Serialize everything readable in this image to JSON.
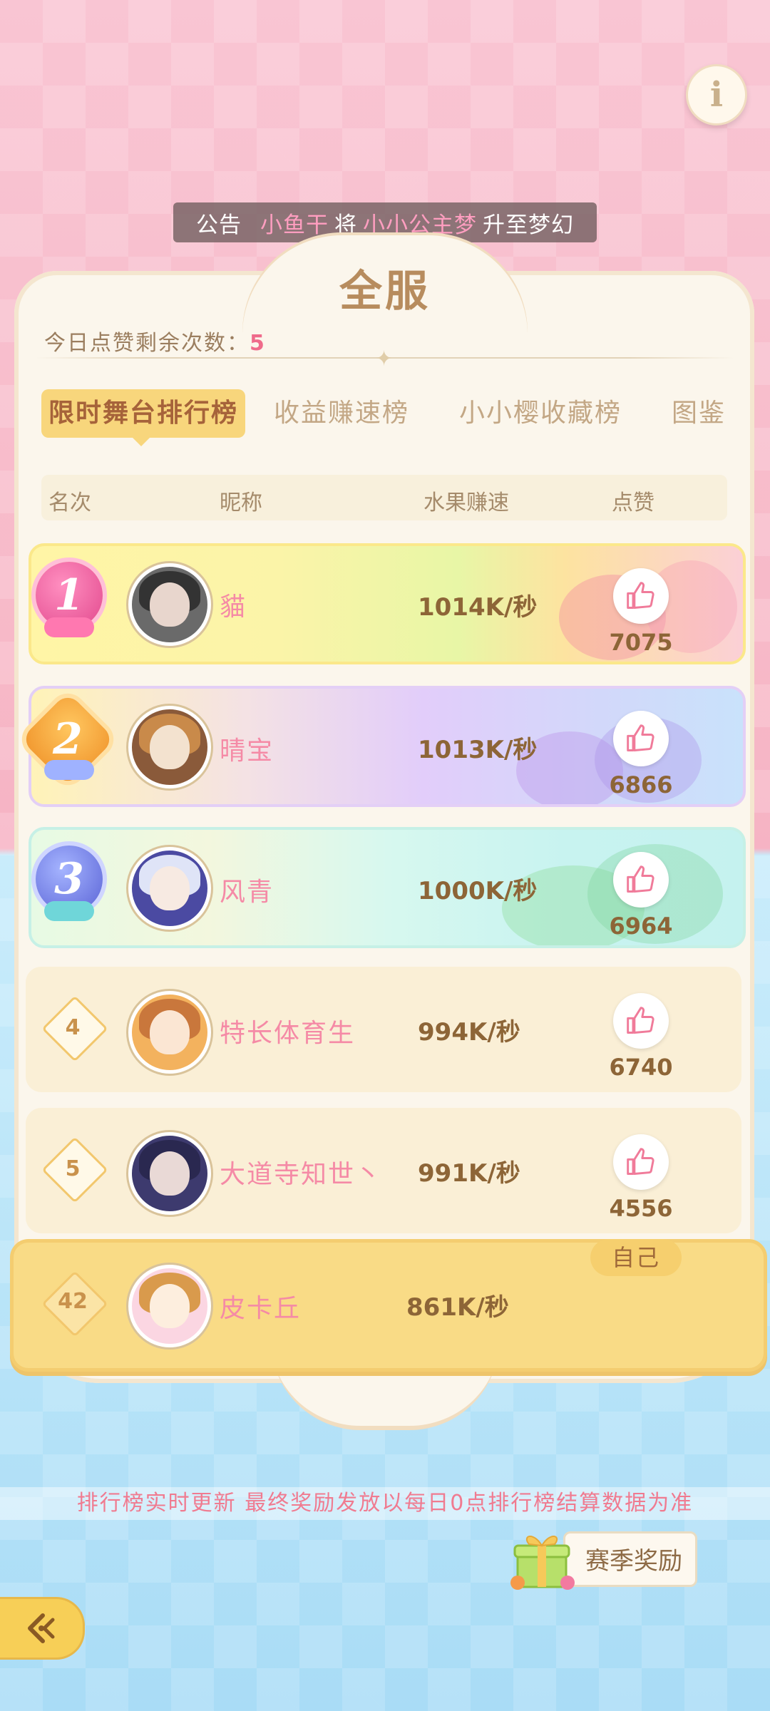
{
  "notice": {
    "label": "公告",
    "user": "小鱼干",
    "verb": "将",
    "target": "小小公主梦",
    "result": "升至梦幻"
  },
  "panel": {
    "title": "全服",
    "likes_remaining_label": "今日点赞剩余次数：",
    "likes_remaining_value": "5"
  },
  "tabs": [
    {
      "label": "限时舞台排行榜",
      "active": true
    },
    {
      "label": "收益赚速榜",
      "active": false
    },
    {
      "label": "小小樱收藏榜",
      "active": false
    },
    {
      "label": "图鉴",
      "active": false
    }
  ],
  "columns": {
    "rank": "名次",
    "nickname": "昵称",
    "speed": "水果赚速",
    "like": "点赞"
  },
  "rows": [
    {
      "rank": "1",
      "name": "貓",
      "speed": "1014K/秒",
      "likes": "7075"
    },
    {
      "rank": "2",
      "name": "晴宝",
      "speed": "1013K/秒",
      "likes": "6866"
    },
    {
      "rank": "3",
      "name": "风青",
      "speed": "1000K/秒",
      "likes": "6964"
    },
    {
      "rank": "4",
      "name": "特长体育生",
      "speed": "994K/秒",
      "likes": "6740"
    },
    {
      "rank": "5",
      "name": "大道寺知世丶",
      "speed": "991K/秒",
      "likes": "4556"
    }
  ],
  "self": {
    "badge": "自己",
    "rank": "42",
    "name": "皮卡丘",
    "speed": "861K/秒"
  },
  "footer": {
    "tip": "排行榜实时更新 最终奖励发放以每日0点排行榜结算数据为准",
    "season_button": "赛季奖励"
  },
  "icons": {
    "info": "info-icon",
    "like": "thumbs-up-icon",
    "back": "back-arrow-icon",
    "gift": "gift-box-icon"
  },
  "colors": {
    "accent_pink": "#f58aa6",
    "brown_text": "#8d6537",
    "tab_active_bg": "#f8d67c"
  }
}
